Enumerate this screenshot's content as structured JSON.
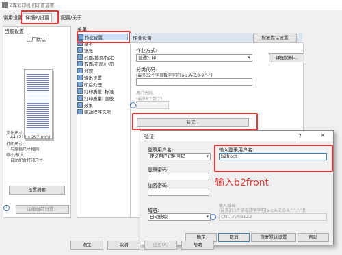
{
  "window": {
    "title": "Z库彩印机 打印首选项"
  },
  "tabs": [
    {
      "label": "常用设置"
    },
    {
      "label": "详细的设置"
    },
    {
      "label": "配置/关于"
    }
  ],
  "left_panel": {
    "title": "当前设置",
    "paper_name": "工厂默认",
    "file_size_label": "文件尺寸:",
    "file_size_value": "A4 (210 x 297 mm)",
    "print_size_label": "打印尺寸:",
    "print_size_value": "与原稿尺寸相同",
    "zoom_label": "缩小/放大:",
    "zoom_value": "自动配合打印尺寸",
    "summary_button": "设置摘要",
    "register_button": "注册当前设置..."
  },
  "tree": {
    "header": "菜单:",
    "items": [
      {
        "label": "作业设置"
      },
      {
        "label": "基本"
      },
      {
        "label": "纸张"
      },
      {
        "label": "封面/插页/指定"
      },
      {
        "label": "双面/布局/小册"
      },
      {
        "label": "外观"
      },
      {
        "label": "输出设置"
      },
      {
        "label": "印后处理"
      },
      {
        "label": "打印质量: 标准"
      },
      {
        "label": "打印质量: 高级"
      },
      {
        "label": "效果"
      },
      {
        "label": "驱动程序选项"
      }
    ]
  },
  "job_settings": {
    "section_title": "作业设置",
    "restore_button": "恢复默认设置",
    "job_mode_label": "作业方式:",
    "job_mode_value": "普通打印",
    "details_button": "详细资料...",
    "category_label": "分类代码:",
    "category_hint": "(最多32个字母数字字符[a-z,A-Z,0-9,\"-\"])",
    "user_code_label": "用户代码:",
    "user_code_hint": "(最多8个数字)",
    "auth_button": "验证..."
  },
  "auth_dialog": {
    "title": "验证",
    "help_glyph": "?",
    "close_glyph": "✕",
    "login_user_label": "登录用户名:",
    "login_user_value": "定义用户识别号码",
    "input_user_label": "输入登录用户名:",
    "input_user_value": "b2front",
    "password_label": "登录密码:",
    "encrypt_label": "加密密码:",
    "domain_label": "域名:",
    "domain_value": "自动获取",
    "enter_domain_label": "输入域名:",
    "enter_domain_hint": "(最多211个字母数字字符[a-z,A-Z,0-9,\".\",\"-\"])",
    "domain_placeholder": "CNL-3V6B1Z2",
    "ok_button": "确定",
    "cancel_button": "取消",
    "restore_button": "恢复默认设置",
    "help_button": "帮助"
  },
  "annotation": {
    "text": "输入b2front",
    "color": "#e53935"
  },
  "bottom_buttons": [
    {
      "label": "确定"
    },
    {
      "label": "取消"
    },
    {
      "label": "应用(A)"
    },
    {
      "label": "帮助"
    }
  ]
}
